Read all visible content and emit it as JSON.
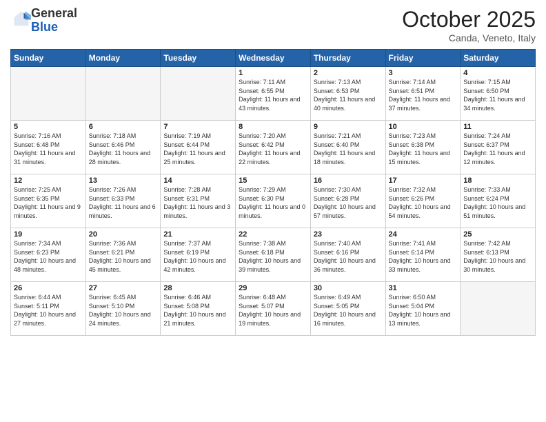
{
  "header": {
    "logo_general": "General",
    "logo_blue": "Blue",
    "title": "October 2025",
    "subtitle": "Canda, Veneto, Italy"
  },
  "days_of_week": [
    "Sunday",
    "Monday",
    "Tuesday",
    "Wednesday",
    "Thursday",
    "Friday",
    "Saturday"
  ],
  "weeks": [
    [
      {
        "day": "",
        "info": ""
      },
      {
        "day": "",
        "info": ""
      },
      {
        "day": "",
        "info": ""
      },
      {
        "day": "1",
        "info": "Sunrise: 7:11 AM\nSunset: 6:55 PM\nDaylight: 11 hours and 43 minutes."
      },
      {
        "day": "2",
        "info": "Sunrise: 7:13 AM\nSunset: 6:53 PM\nDaylight: 11 hours and 40 minutes."
      },
      {
        "day": "3",
        "info": "Sunrise: 7:14 AM\nSunset: 6:51 PM\nDaylight: 11 hours and 37 minutes."
      },
      {
        "day": "4",
        "info": "Sunrise: 7:15 AM\nSunset: 6:50 PM\nDaylight: 11 hours and 34 minutes."
      }
    ],
    [
      {
        "day": "5",
        "info": "Sunrise: 7:16 AM\nSunset: 6:48 PM\nDaylight: 11 hours and 31 minutes."
      },
      {
        "day": "6",
        "info": "Sunrise: 7:18 AM\nSunset: 6:46 PM\nDaylight: 11 hours and 28 minutes."
      },
      {
        "day": "7",
        "info": "Sunrise: 7:19 AM\nSunset: 6:44 PM\nDaylight: 11 hours and 25 minutes."
      },
      {
        "day": "8",
        "info": "Sunrise: 7:20 AM\nSunset: 6:42 PM\nDaylight: 11 hours and 22 minutes."
      },
      {
        "day": "9",
        "info": "Sunrise: 7:21 AM\nSunset: 6:40 PM\nDaylight: 11 hours and 18 minutes."
      },
      {
        "day": "10",
        "info": "Sunrise: 7:23 AM\nSunset: 6:38 PM\nDaylight: 11 hours and 15 minutes."
      },
      {
        "day": "11",
        "info": "Sunrise: 7:24 AM\nSunset: 6:37 PM\nDaylight: 11 hours and 12 minutes."
      }
    ],
    [
      {
        "day": "12",
        "info": "Sunrise: 7:25 AM\nSunset: 6:35 PM\nDaylight: 11 hours and 9 minutes."
      },
      {
        "day": "13",
        "info": "Sunrise: 7:26 AM\nSunset: 6:33 PM\nDaylight: 11 hours and 6 minutes."
      },
      {
        "day": "14",
        "info": "Sunrise: 7:28 AM\nSunset: 6:31 PM\nDaylight: 11 hours and 3 minutes."
      },
      {
        "day": "15",
        "info": "Sunrise: 7:29 AM\nSunset: 6:30 PM\nDaylight: 11 hours and 0 minutes."
      },
      {
        "day": "16",
        "info": "Sunrise: 7:30 AM\nSunset: 6:28 PM\nDaylight: 10 hours and 57 minutes."
      },
      {
        "day": "17",
        "info": "Sunrise: 7:32 AM\nSunset: 6:26 PM\nDaylight: 10 hours and 54 minutes."
      },
      {
        "day": "18",
        "info": "Sunrise: 7:33 AM\nSunset: 6:24 PM\nDaylight: 10 hours and 51 minutes."
      }
    ],
    [
      {
        "day": "19",
        "info": "Sunrise: 7:34 AM\nSunset: 6:23 PM\nDaylight: 10 hours and 48 minutes."
      },
      {
        "day": "20",
        "info": "Sunrise: 7:36 AM\nSunset: 6:21 PM\nDaylight: 10 hours and 45 minutes."
      },
      {
        "day": "21",
        "info": "Sunrise: 7:37 AM\nSunset: 6:19 PM\nDaylight: 10 hours and 42 minutes."
      },
      {
        "day": "22",
        "info": "Sunrise: 7:38 AM\nSunset: 6:18 PM\nDaylight: 10 hours and 39 minutes."
      },
      {
        "day": "23",
        "info": "Sunrise: 7:40 AM\nSunset: 6:16 PM\nDaylight: 10 hours and 36 minutes."
      },
      {
        "day": "24",
        "info": "Sunrise: 7:41 AM\nSunset: 6:14 PM\nDaylight: 10 hours and 33 minutes."
      },
      {
        "day": "25",
        "info": "Sunrise: 7:42 AM\nSunset: 6:13 PM\nDaylight: 10 hours and 30 minutes."
      }
    ],
    [
      {
        "day": "26",
        "info": "Sunrise: 6:44 AM\nSunset: 5:11 PM\nDaylight: 10 hours and 27 minutes."
      },
      {
        "day": "27",
        "info": "Sunrise: 6:45 AM\nSunset: 5:10 PM\nDaylight: 10 hours and 24 minutes."
      },
      {
        "day": "28",
        "info": "Sunrise: 6:46 AM\nSunset: 5:08 PM\nDaylight: 10 hours and 21 minutes."
      },
      {
        "day": "29",
        "info": "Sunrise: 6:48 AM\nSunset: 5:07 PM\nDaylight: 10 hours and 19 minutes."
      },
      {
        "day": "30",
        "info": "Sunrise: 6:49 AM\nSunset: 5:05 PM\nDaylight: 10 hours and 16 minutes."
      },
      {
        "day": "31",
        "info": "Sunrise: 6:50 AM\nSunset: 5:04 PM\nDaylight: 10 hours and 13 minutes."
      },
      {
        "day": "",
        "info": ""
      }
    ]
  ]
}
